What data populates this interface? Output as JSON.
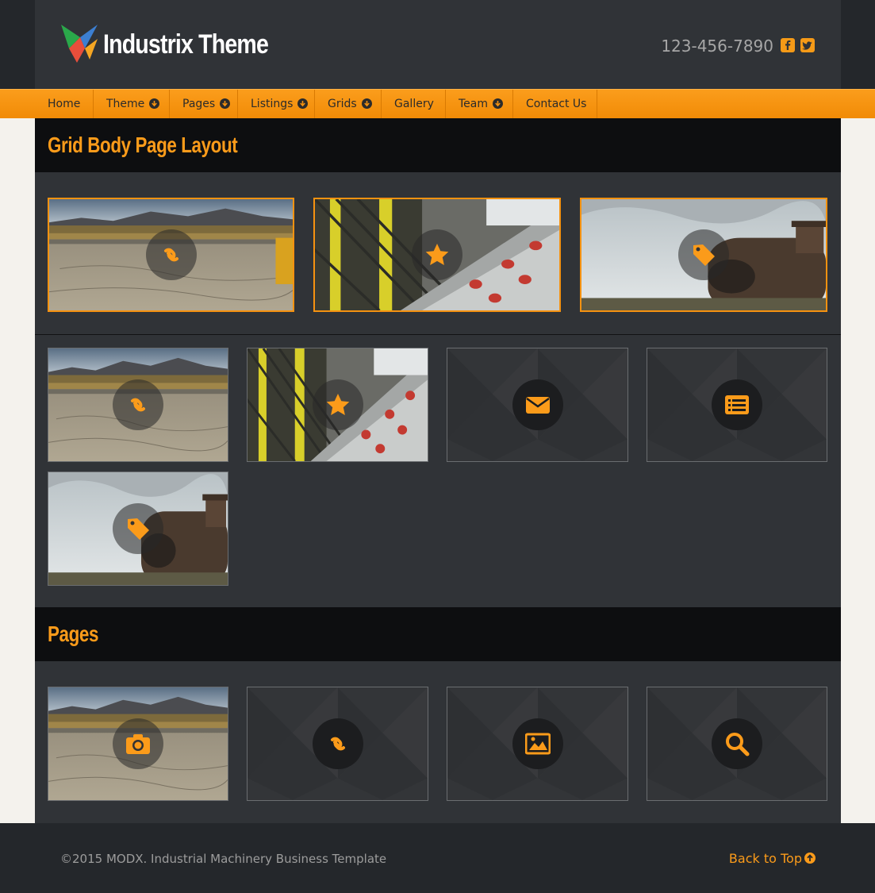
{
  "header": {
    "brand": "Industrix Theme",
    "phone": "123-456-7890",
    "social": [
      "facebook-icon",
      "twitter-icon"
    ],
    "accent_color": "#fb9b1a"
  },
  "nav": {
    "items": [
      {
        "label": "Home",
        "has_dropdown": false
      },
      {
        "label": "Theme",
        "has_dropdown": true
      },
      {
        "label": "Pages",
        "has_dropdown": true
      },
      {
        "label": "Listings",
        "has_dropdown": true
      },
      {
        "label": "Grids",
        "has_dropdown": true
      },
      {
        "label": "Gallery",
        "has_dropdown": false
      },
      {
        "label": "Team",
        "has_dropdown": true
      },
      {
        "label": "Contact Us",
        "has_dropdown": false
      }
    ]
  },
  "sections": [
    {
      "title": "Grid Body Page Layout",
      "featured_tiles": [
        {
          "image": "landscape",
          "icon": "link-icon"
        },
        {
          "image": "machinery",
          "icon": "star-icon"
        },
        {
          "image": "locomotive",
          "icon": "tag-icon"
        }
      ],
      "tiles": [
        {
          "image": "landscape",
          "icon": "link-icon"
        },
        {
          "image": "machinery",
          "icon": "star-icon"
        },
        {
          "image": "pattern",
          "icon": "envelope-icon"
        },
        {
          "image": "pattern",
          "icon": "list-icon"
        },
        {
          "image": "locomotive",
          "icon": "tag-icon"
        }
      ]
    },
    {
      "title": "Pages",
      "tiles": [
        {
          "image": "landscape",
          "icon": "camera-icon"
        },
        {
          "image": "pattern",
          "icon": "link-icon"
        },
        {
          "image": "pattern",
          "icon": "picture-icon"
        },
        {
          "image": "pattern",
          "icon": "search-icon"
        }
      ]
    }
  ],
  "footer": {
    "copyright": "©2015 MODX. Industrial Machinery Business Template",
    "back_to_top": "Back to Top"
  }
}
